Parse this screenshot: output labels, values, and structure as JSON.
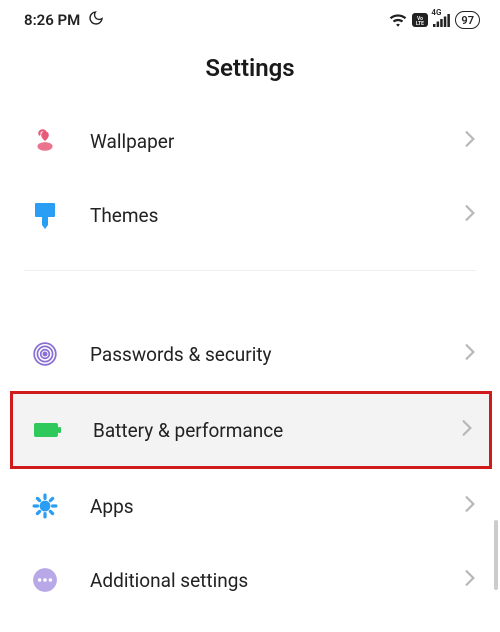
{
  "status": {
    "time": "8:26 PM",
    "battery": "97",
    "network_label": "4G"
  },
  "page": {
    "title": "Settings"
  },
  "rows": {
    "wallpaper": {
      "label": "Wallpaper"
    },
    "themes": {
      "label": "Themes"
    },
    "passwords": {
      "label": "Passwords & security"
    },
    "battery": {
      "label": "Battery & performance"
    },
    "apps": {
      "label": "Apps"
    },
    "additional": {
      "label": "Additional settings"
    }
  }
}
